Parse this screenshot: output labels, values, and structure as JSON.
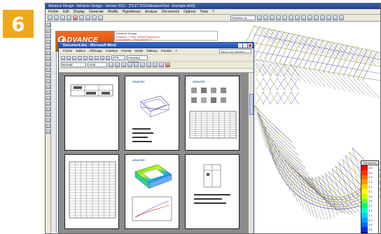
{
  "badge": "6",
  "app": {
    "title": "Advance Design - Advance Design - Version 2011 - [TEST 2011\\Advance\\Test - Exemple.ADD]",
    "menu": [
      "Fichier",
      "Edit",
      "Display",
      "Generate",
      "Modify",
      "Hypotheses",
      "Analyse",
      "Documents",
      "Options",
      "Tools",
      "?"
    ],
    "selection_box": "Selection by"
  },
  "logo": {
    "text": "ADVANCE",
    "mark": "G"
  },
  "messages": [
    "Advance Design",
    "Analysis > Fluid 'Word/Paged/docs'",
    "Documents > Fluid results 'Y'"
  ],
  "word": {
    "title": "Document.doc - Microsoft Word",
    "menu": [
      "Fichier",
      "Edition",
      "Affichage",
      "Insertion",
      "Format",
      "Outils",
      "Tableau",
      "Fenetre",
      "?"
    ],
    "help_placeholder": "Tapez une question",
    "zoom": "27%",
    "read_mode": "Prédéfinir marques",
    "style": "Normal",
    "font": "Arial",
    "page_text": {
      "p2_heading": "Groupe",
      "logo_small": "GRAITEC"
    }
  },
  "colorbar": {
    "title": "Deformees",
    "values": [
      "2.8",
      "2.6",
      "2.5",
      "2.3",
      "2.1",
      "2.0",
      "1.8",
      "1.6",
      "1.4",
      "1.3",
      "1.1",
      "0.9",
      "0.8",
      "0.6",
      "0.4"
    ],
    "colors": [
      "#ff0000",
      "#ff3300",
      "#ff6600",
      "#ff9900",
      "#ffcc00",
      "#ffff00",
      "#ccff00",
      "#66ff33",
      "#00ff66",
      "#00ffcc",
      "#00ccff",
      "#0099ff",
      "#0066ff",
      "#0033cc",
      "#000099"
    ]
  },
  "icons": {
    "app_toolbar": [
      "new-icon",
      "open-icon",
      "save-icon",
      "print-icon",
      "cut-icon",
      "copy-icon",
      "paste-icon",
      "undo-icon",
      "redo-icon"
    ],
    "word_toolbar": [
      "new-doc-icon",
      "open-doc-icon",
      "save-doc-icon",
      "print-doc-icon",
      "preview-icon",
      "spell-icon",
      "bold-icon",
      "italic-icon",
      "underline-icon"
    ]
  }
}
